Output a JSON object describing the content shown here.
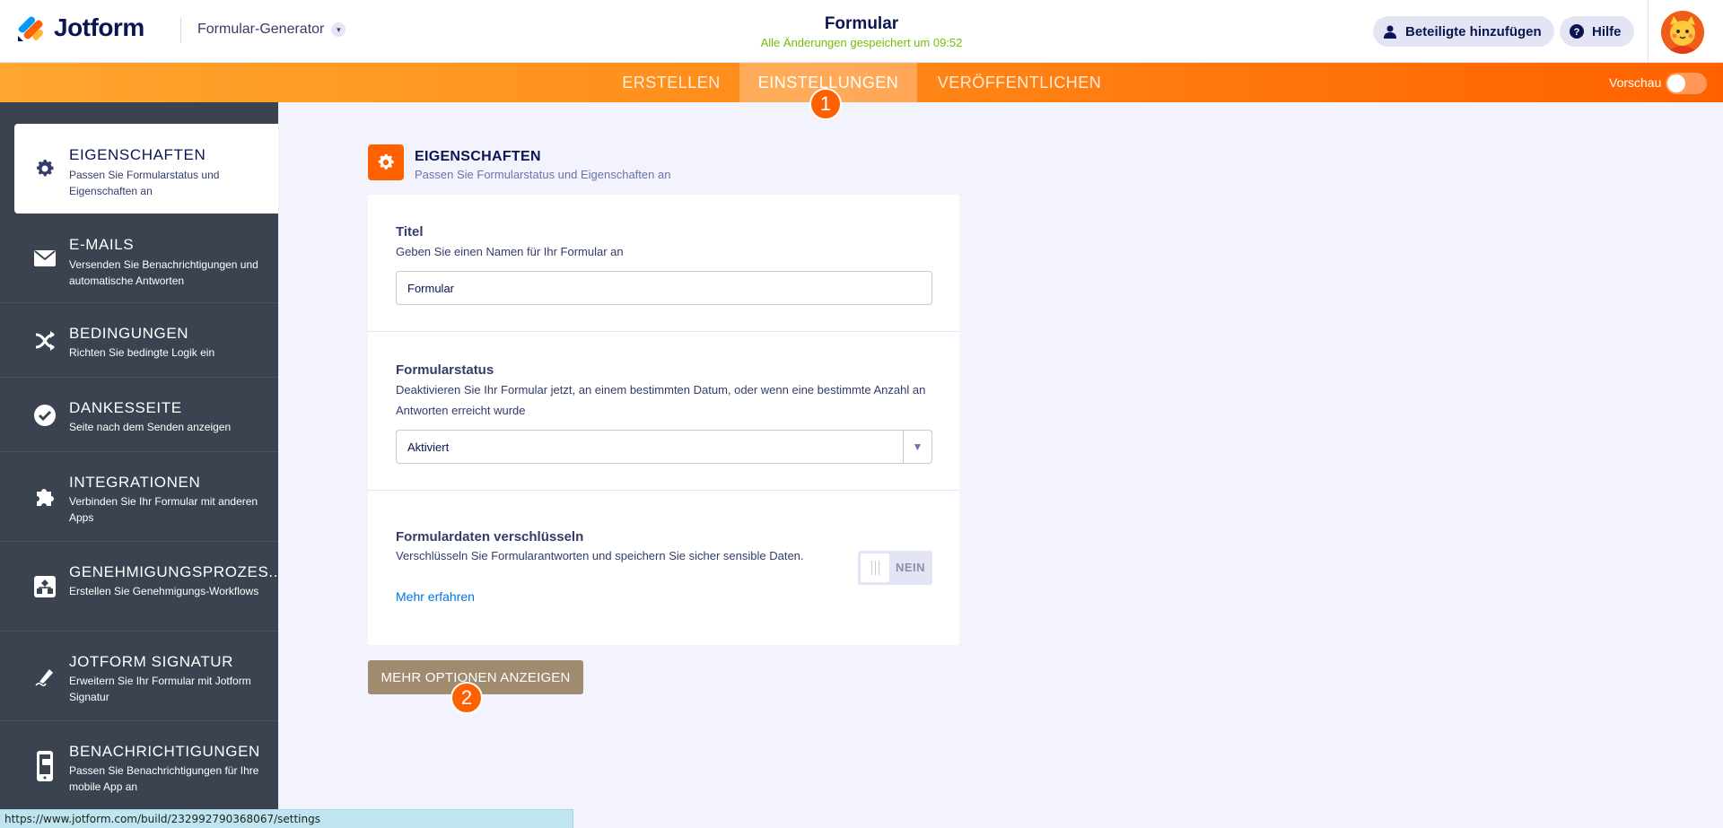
{
  "header": {
    "brand": "Jotform",
    "builder_select": "Formular-Generator",
    "form_title": "Formular",
    "save_status": "Alle Änderungen gespeichert um 09:52",
    "add_participants": "Beteiligte hinzufügen",
    "help": "Hilfe"
  },
  "nav": {
    "tabs": [
      {
        "label": "ERSTELLEN",
        "active": false
      },
      {
        "label": "EINSTELLUNGEN",
        "active": true
      },
      {
        "label": "VERÖFFENTLICHEN",
        "active": false
      }
    ],
    "preview_label": "Vorschau",
    "preview_on": false
  },
  "badges": {
    "one": "1",
    "two": "2"
  },
  "sidebar": {
    "items": [
      {
        "title": "EIGENSCHAFTEN",
        "desc": "Passen Sie Formularstatus und Eigenschaften an",
        "icon": "gear-icon",
        "active": true
      },
      {
        "title": "E-MAILS",
        "desc": "Versenden Sie Benachrichtigungen und automatische Antworten",
        "icon": "envelope-icon"
      },
      {
        "title": "BEDINGUNGEN",
        "desc": "Richten Sie bedingte Logik ein",
        "icon": "shuffle-icon"
      },
      {
        "title": "DANKESSEITE",
        "desc": "Seite nach dem Senden anzeigen",
        "icon": "check-circle-icon"
      },
      {
        "title": "INTEGRATIONEN",
        "desc": "Verbinden Sie Ihr Formular mit anderen Apps",
        "icon": "puzzle-icon"
      },
      {
        "title": "GENEHMIGUNGSPROZES...",
        "desc": "Erstellen Sie Genehmigungs-Workflows",
        "icon": "workflow-icon"
      },
      {
        "title": "JOTFORM SIGNATUR",
        "desc": "Erweitern Sie Ihr Formular mit Jotform Signatur",
        "icon": "pen-icon"
      },
      {
        "title": "BENACHRICHTIGUNGEN",
        "desc": "Passen Sie Benachrichtigungen für Ihre mobile App an",
        "icon": "mobile-icon"
      }
    ]
  },
  "section": {
    "title": "EIGENSCHAFTEN",
    "desc": "Passen Sie Formularstatus und Eigenschaften an"
  },
  "fields": {
    "title_label": "Titel",
    "title_desc": "Geben Sie einen Namen für Ihr Formular an",
    "title_value": "Formular",
    "status_label": "Formularstatus",
    "status_desc": "Deaktivieren Sie Ihr Formular jetzt, an einem bestimmten Datum, oder wenn eine bestimmte Anzahl an Antworten erreicht wurde",
    "status_value": "Aktiviert",
    "encrypt_label": "Formulardaten verschlüsseln",
    "encrypt_desc": "Verschlüsseln Sie Formularantworten und speichern Sie sicher sensible Daten.",
    "encrypt_link": "Mehr erfahren",
    "encrypt_toggle": "NEIN"
  },
  "more_options": "MEHR OPTIONEN ANZEIGEN",
  "status_url": "https://www.jotform.com/build/232992790368067/settings",
  "colors": {
    "accent": "#ff6100",
    "sidebar": "#3b4250",
    "link": "#0075e3",
    "saved": "#78bb07"
  }
}
